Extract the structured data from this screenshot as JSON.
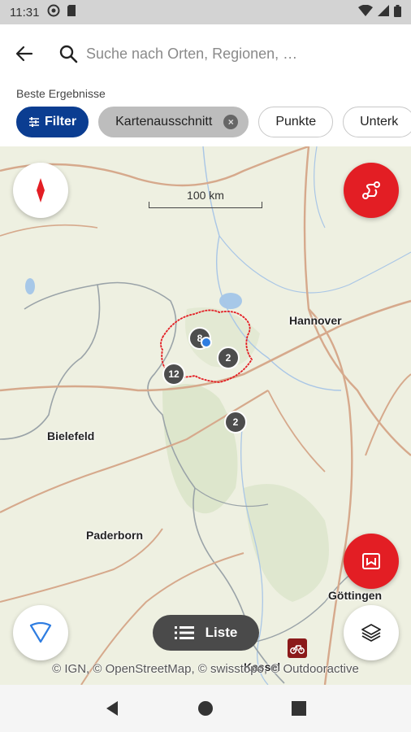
{
  "status_bar": {
    "time": "11:31"
  },
  "header": {
    "search_placeholder": "Suche nach Orten, Regionen, …",
    "section_label": "Beste Ergebnisse",
    "chips": [
      {
        "label": "Filter",
        "state": "primary"
      },
      {
        "label": "Kartenausschnitt",
        "state": "selected"
      },
      {
        "label": "Punkte",
        "state": "default"
      },
      {
        "label": "Unterk",
        "state": "default"
      }
    ]
  },
  "map": {
    "scale_label": "100 km",
    "cities": {
      "hannover": "Hannover",
      "bielefeld": "Bielefeld",
      "paderborn": "Paderborn",
      "goettingen": "Göttingen",
      "kassel": "Kassel"
    },
    "clusters": [
      "8",
      "2",
      "12",
      "2"
    ],
    "attribution": "© IGN, © OpenStreetMap, © swisstopo, © Outdooractive",
    "list_button": "Liste"
  },
  "colors": {
    "primary_blue": "#0b3d91",
    "accent_red": "#e31e24",
    "map_background": "#eef0e1",
    "road_color": "#d6a98c",
    "region_outline": "#e31e24"
  }
}
